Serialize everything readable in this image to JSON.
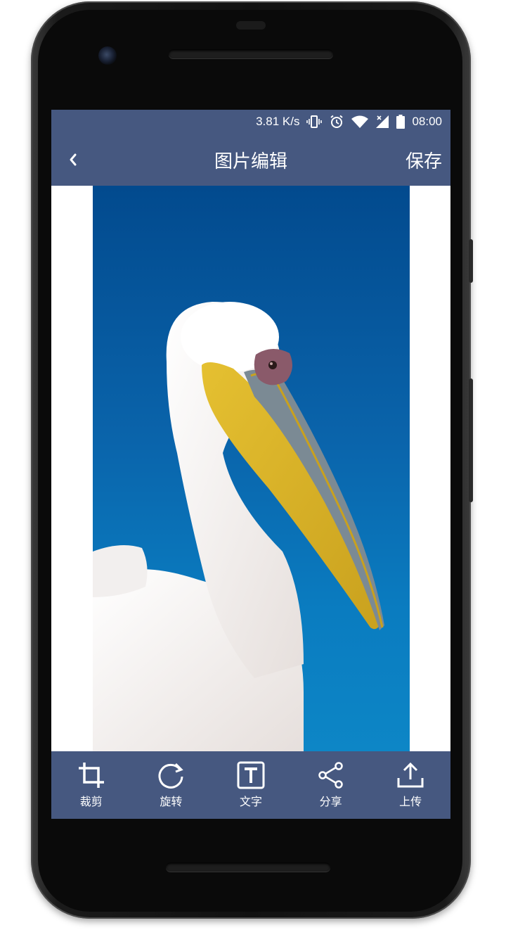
{
  "status_bar": {
    "network_speed": "3.81 K/s",
    "time": "08:00",
    "icons": [
      "vibrate-icon",
      "alarm-icon",
      "wifi-icon",
      "signal-icon",
      "battery-icon"
    ]
  },
  "app_bar": {
    "back_icon": "chevron-left-icon",
    "title": "图片编辑",
    "save_label": "保存"
  },
  "canvas": {
    "image_subject": "pelican",
    "background_color": "#0a64ab"
  },
  "toolbar": {
    "items": [
      {
        "label": "裁剪",
        "icon": "crop-icon"
      },
      {
        "label": "旋转",
        "icon": "rotate-icon"
      },
      {
        "label": "文字",
        "icon": "text-icon"
      },
      {
        "label": "分享",
        "icon": "share-icon"
      },
      {
        "label": "上传",
        "icon": "upload-icon"
      }
    ]
  },
  "colors": {
    "primary": "#465880",
    "on_primary": "#ffffff"
  }
}
